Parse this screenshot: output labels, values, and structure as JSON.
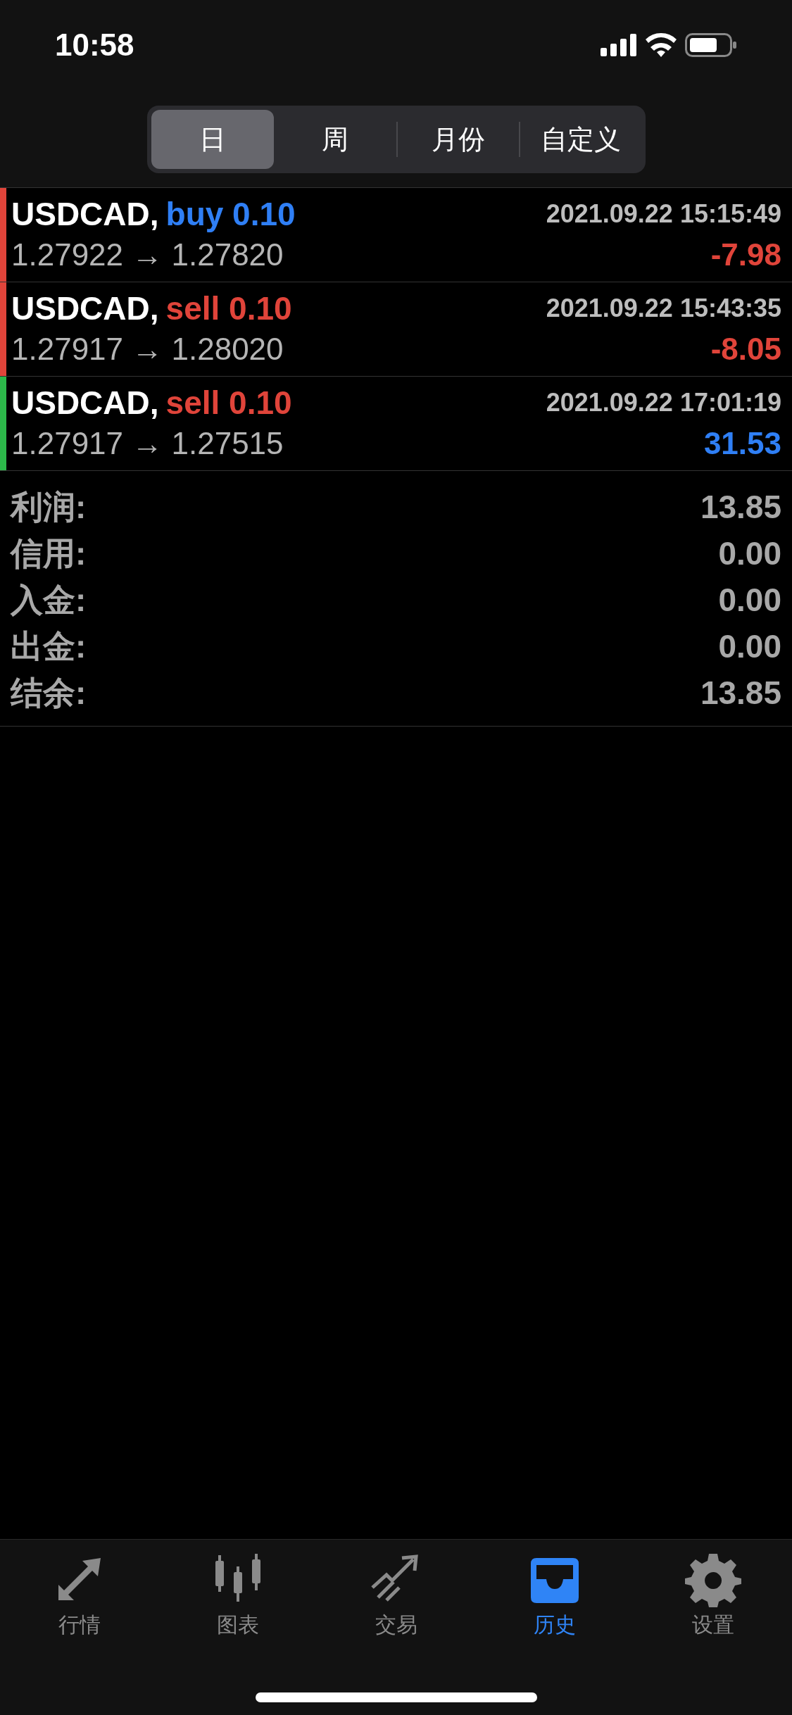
{
  "status_bar": {
    "time": "10:58"
  },
  "periods": [
    {
      "label": "日",
      "selected": true
    },
    {
      "label": "周",
      "selected": false
    },
    {
      "label": "月份",
      "selected": false
    },
    {
      "label": "自定义",
      "selected": false
    }
  ],
  "trades": [
    {
      "symbol": "USDCAD,",
      "order": "buy 0.10",
      "kind": "buy",
      "time": "2021.09.22 15:15:49",
      "prices": "1.27922 → 1.27820",
      "profit": {
        "text": "-7.98",
        "color": "#e0443a"
      },
      "color": "#e0443a"
    },
    {
      "symbol": "USDCAD,",
      "order": "sell 0.10",
      "kind": "sell",
      "time": "2021.09.22 15:43:35",
      "prices": "1.27917 → 1.28020",
      "profit": {
        "text": "-8.05",
        "color": "#e0443a"
      },
      "color": "#e0443a"
    },
    {
      "symbol": "USDCAD,",
      "order": "sell 0.10",
      "kind": "sell",
      "time": "2021.09.22 17:01:19",
      "prices": "1.27917 → 1.27515",
      "profit": {
        "text": "31.53",
        "color": "#2f7ff5"
      },
      "color": "#2db84a"
    }
  ],
  "summary": [
    {
      "label": "利润:",
      "value": "13.85"
    },
    {
      "label": "信用:",
      "value": "0.00"
    },
    {
      "label": "入金:",
      "value": "0.00"
    },
    {
      "label": "出金:",
      "value": "0.00"
    },
    {
      "label": "结余:",
      "value": "13.85"
    }
  ],
  "tab_bar": [
    {
      "label": "行情",
      "kind": "quotes",
      "selected": false
    },
    {
      "label": "图表",
      "kind": "chart",
      "selected": false
    },
    {
      "label": "交易",
      "kind": "trade",
      "selected": false
    },
    {
      "label": "历史",
      "kind": "history",
      "selected": true
    },
    {
      "label": "设置",
      "kind": "settings",
      "selected": false
    }
  ]
}
